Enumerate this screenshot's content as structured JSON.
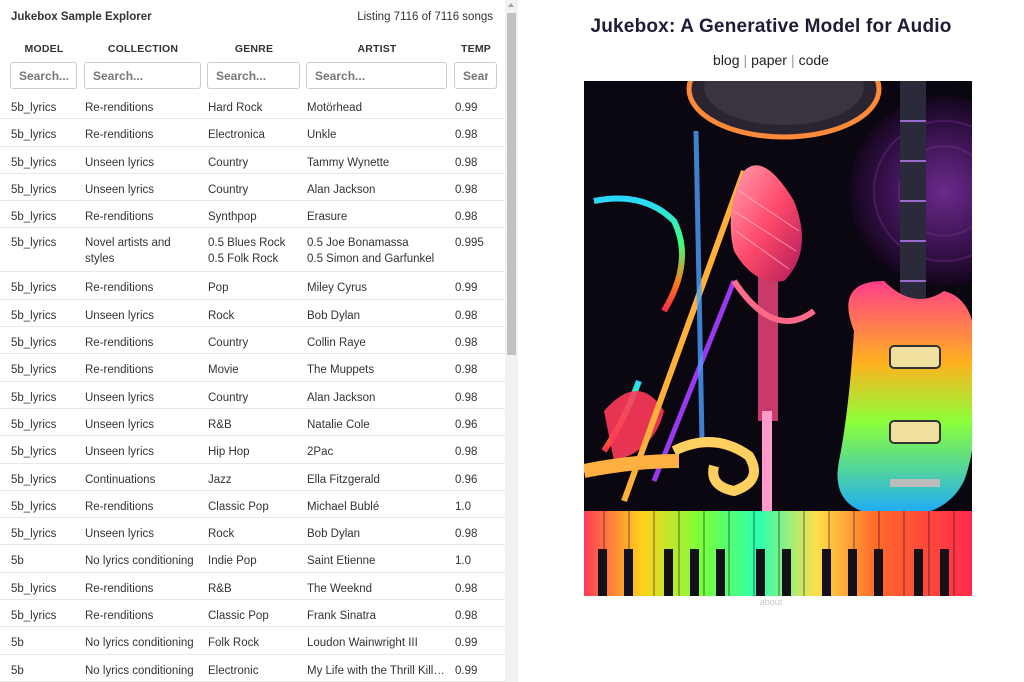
{
  "explorer": {
    "title": "Jukebox Sample Explorer",
    "listing": "Listing 7116 of 7116 songs",
    "columns": [
      {
        "header": "MODEL",
        "placeholder": "Search..."
      },
      {
        "header": "COLLECTION",
        "placeholder": "Search..."
      },
      {
        "header": "GENRE",
        "placeholder": "Search..."
      },
      {
        "header": "ARTIST",
        "placeholder": "Search..."
      },
      {
        "header": "TEMP",
        "placeholder": "Search..."
      }
    ],
    "rows": [
      {
        "model": "5b_lyrics",
        "collection": "Re-renditions",
        "genre": "Hard Rock",
        "artist": "Motörhead",
        "temp": "0.99"
      },
      {
        "model": "5b_lyrics",
        "collection": "Re-renditions",
        "genre": "Electronica",
        "artist": "Unkle",
        "temp": "0.98"
      },
      {
        "model": "5b_lyrics",
        "collection": "Unseen lyrics",
        "genre": "Country",
        "artist": "Tammy Wynette",
        "temp": "0.98"
      },
      {
        "model": "5b_lyrics",
        "collection": "Unseen lyrics",
        "genre": "Country",
        "artist": "Alan Jackson",
        "temp": "0.98"
      },
      {
        "model": "5b_lyrics",
        "collection": "Re-renditions",
        "genre": "Synthpop",
        "artist": "Erasure",
        "temp": "0.98"
      },
      {
        "model": "5b_lyrics",
        "collection": "Novel artists and styles",
        "genre": "0.5 Blues Rock",
        "genre2": "0.5 Folk Rock",
        "artist": "0.5 Joe Bonamassa",
        "artist2": "0.5 Simon and Garfunkel",
        "temp": "0.995"
      },
      {
        "model": "5b_lyrics",
        "collection": "Re-renditions",
        "genre": "Pop",
        "artist": "Miley Cyrus",
        "temp": "0.99"
      },
      {
        "model": "5b_lyrics",
        "collection": "Unseen lyrics",
        "genre": "Rock",
        "artist": "Bob Dylan",
        "temp": "0.98"
      },
      {
        "model": "5b_lyrics",
        "collection": "Re-renditions",
        "genre": "Country",
        "artist": "Collin Raye",
        "temp": "0.98"
      },
      {
        "model": "5b_lyrics",
        "collection": "Re-renditions",
        "genre": "Movie",
        "artist": "The Muppets",
        "temp": "0.98"
      },
      {
        "model": "5b_lyrics",
        "collection": "Unseen lyrics",
        "genre": "Country",
        "artist": "Alan Jackson",
        "temp": "0.98"
      },
      {
        "model": "5b_lyrics",
        "collection": "Unseen lyrics",
        "genre": "R&B",
        "artist": "Natalie Cole",
        "temp": "0.96"
      },
      {
        "model": "5b_lyrics",
        "collection": "Unseen lyrics",
        "genre": "Hip Hop",
        "artist": "2Pac",
        "temp": "0.98"
      },
      {
        "model": "5b_lyrics",
        "collection": "Continuations",
        "genre": "Jazz",
        "artist": "Ella Fitzgerald",
        "temp": "0.96"
      },
      {
        "model": "5b_lyrics",
        "collection": "Re-renditions",
        "genre": "Classic Pop",
        "artist": "Michael Bublé",
        "temp": "1.0"
      },
      {
        "model": "5b_lyrics",
        "collection": "Unseen lyrics",
        "genre": "Rock",
        "artist": "Bob Dylan",
        "temp": "0.98"
      },
      {
        "model": "5b",
        "collection": "No lyrics conditioning",
        "genre": "Indie Pop",
        "artist": "Saint Etienne",
        "temp": "1.0"
      },
      {
        "model": "5b_lyrics",
        "collection": "Re-renditions",
        "genre": "R&B",
        "artist": "The Weeknd",
        "temp": "0.98"
      },
      {
        "model": "5b_lyrics",
        "collection": "Re-renditions",
        "genre": "Classic Pop",
        "artist": "Frank Sinatra",
        "temp": "0.98"
      },
      {
        "model": "5b",
        "collection": "No lyrics conditioning",
        "genre": "Folk Rock",
        "artist": "Loudon Wainwright III",
        "temp": "0.99"
      },
      {
        "model": "5b",
        "collection": "No lyrics conditioning",
        "genre": "Electronic",
        "artist": "My Life with the Thrill Kill Kult",
        "temp": "0.99"
      }
    ]
  },
  "page": {
    "title": "Jukebox: A Generative Model for Audio",
    "links": [
      "blog",
      "paper",
      "code"
    ],
    "separator": "|",
    "footer": "about"
  }
}
